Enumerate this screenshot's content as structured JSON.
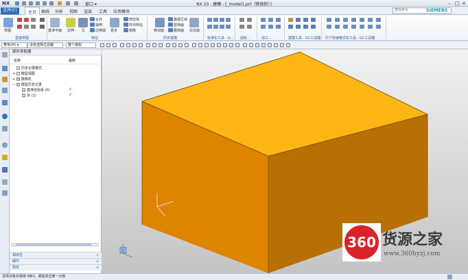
{
  "titlebar": {
    "logo": "NX",
    "window_menu": "窗口 ▾",
    "title": "NX 10 - 建模 - [_model1.prt（修改的）]"
  },
  "tabs": {
    "file": "文件(F)",
    "items": [
      "主页",
      "曲线",
      "分析",
      "视图",
      "渲染",
      "工具",
      "应用模块"
    ],
    "active_index": 0
  },
  "search": {
    "placeholder": "查找命令"
  },
  "brand": "SIEMENS",
  "ribbon": {
    "groups": [
      {
        "label": "直接草图"
      },
      {
        "label": "特征"
      },
      {
        "label": "同步建模"
      },
      {
        "label": "标准化工具 - G..."
      },
      {
        "label": "齿轮..."
      },
      {
        "label": "加工..."
      },
      {
        "label": "建模工具 - GC工具箱"
      },
      {
        "label": "尺寸快速格式化工具 - GC工具箱"
      }
    ],
    "labels": {
      "sketch": "草图",
      "datum_plane": "基准平面",
      "extrude": "拉伸",
      "hole": "孔",
      "unite": "合并",
      "shell": "抽壳",
      "edge_blend": "边倒圆",
      "chamfer": "倒斜角",
      "more": "更多",
      "offset_region": "偏置区域",
      "replace_face": "替换面",
      "delete_face": "删除面",
      "move_face": "移动面",
      "pull_face": "拉出面",
      "draft": "拔模",
      "trim_body": "修剪体",
      "pattern_feature": "阵列特征",
      "mirror": "镜像"
    }
  },
  "selection": {
    "menu": "菜单(M) ▾",
    "filter": "没有选择过滤器",
    "scope": "整个装配"
  },
  "navigator": {
    "title": "部件导航器",
    "col_name": "名称",
    "col_latest": "最新",
    "nodes": [
      {
        "label": "历史记录模式",
        "check": ""
      },
      {
        "label": "模型视图",
        "check": ""
      },
      {
        "label": "摄像机",
        "check": ""
      },
      {
        "label": "模型历史记录",
        "check": ""
      },
      {
        "label": "基准坐标系 (0)",
        "check": "✔"
      },
      {
        "label": "块 (1)",
        "check": "✔"
      }
    ],
    "panels": [
      "相依性",
      "细节",
      "预览"
    ]
  },
  "status": {
    "text": "选择对象并使用 MB3，或者双击某一对象"
  },
  "watermark": {
    "logo": "360",
    "text": "货源之家",
    "url": "www.360hyzj.com"
  },
  "colors": {
    "block_top": "#fdb614",
    "block_front": "#de8400",
    "block_side": "#b86f03",
    "accent": "#2c6fb7",
    "watermark_red": "#d9232a"
  }
}
